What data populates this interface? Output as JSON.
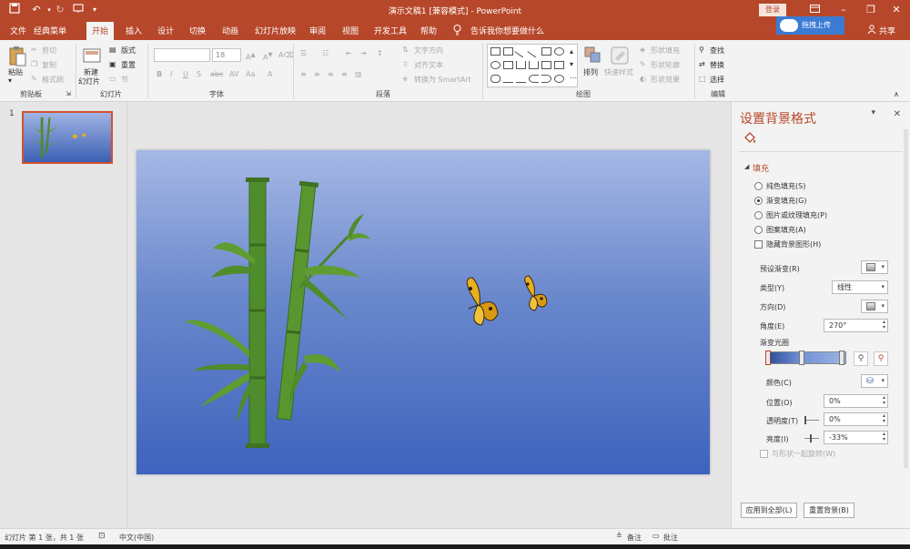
{
  "window": {
    "title": "演示文稿1 [兼容模式] - PowerPoint",
    "login_label": "登录",
    "share_label": "共享",
    "upload_label": "拖拽上传"
  },
  "tabs": [
    "文件",
    "经典菜单",
    "开始",
    "插入",
    "设计",
    "切换",
    "动画",
    "幻灯片放映",
    "审阅",
    "视图",
    "开发工具",
    "帮助"
  ],
  "tell_me": "告诉我你想要做什么",
  "ribbon": {
    "clipboard": {
      "label": "剪贴板",
      "paste": "粘贴",
      "cut": "剪切",
      "copy": "复制",
      "format_painter": "格式刷"
    },
    "slides": {
      "label": "幻灯片",
      "new_slide_1": "新建",
      "new_slide_2": "幻灯片",
      "layout": "版式",
      "reset": "重置",
      "section": "节"
    },
    "font": {
      "label": "字体",
      "font_size": "18"
    },
    "paragraph": {
      "label": "段落",
      "text_direction": "文字方向",
      "align_text": "对齐文本",
      "smartart": "转换为 SmartArt"
    },
    "drawing": {
      "label": "绘图",
      "arrange": "排列",
      "quick_styles": "快速样式",
      "shape_fill": "形状填充",
      "shape_outline": "形状轮廓",
      "shape_effects": "形状效果"
    },
    "editing": {
      "label": "编辑",
      "find": "查找",
      "replace": "替换",
      "select": "选择"
    }
  },
  "thumbnail": {
    "number": "1"
  },
  "format_panel": {
    "title": "设置背景格式",
    "section": "填充",
    "fill_options": [
      {
        "label": "纯色填充(S)",
        "selected": false
      },
      {
        "label": "渐变填充(G)",
        "selected": true
      },
      {
        "label": "图片或纹理填充(P)",
        "selected": false
      },
      {
        "label": "图案填充(A)",
        "selected": false
      }
    ],
    "hide_graphics": "隐藏背景图形(H)",
    "preset_label": "预设渐变(R)",
    "type_label": "类型(Y)",
    "type_value": "线性",
    "direction_label": "方向(D)",
    "angle_label": "角度(E)",
    "angle_value": "270°",
    "stops_label": "渐变光圈",
    "color_label": "颜色(C)",
    "position_label": "位置(O)",
    "position_value": "0%",
    "transparency_label": "透明度(T)",
    "transparency_value": "0%",
    "brightness_label": "亮度(I)",
    "brightness_value": "-33%",
    "rotate_label": "与形状一起旋转(W)",
    "apply_all": "应用到全部(L)",
    "reset_bg": "重置背景(B)",
    "accent_color": "#b7472a"
  },
  "status": {
    "slide_info": "幻灯片 第 1 张，共 1 张",
    "language": "中文(中国)",
    "notes": "备注",
    "comments": "批注"
  }
}
